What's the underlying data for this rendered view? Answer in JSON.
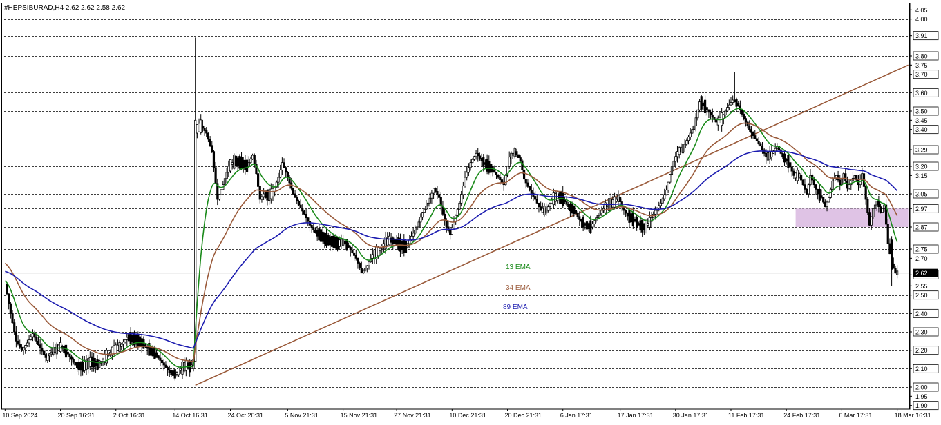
{
  "header": {
    "title": "#HEPSIBURAD,H4  2.62 2.62 2.58 2.62"
  },
  "colors": {
    "background": "#ffffff",
    "grid": "#000000",
    "candle": "#000000",
    "ema13": "#1a8a1a",
    "ema34": "#9a5a3a",
    "ema89": "#1c1cb0",
    "trendline": "#9a5a3a",
    "support_zone": "#d9b8e0",
    "current_price_tag": "#000000"
  },
  "chart_data": {
    "type": "candlestick",
    "symbol": "#HEPSIBURAD",
    "timeframe": "H4",
    "ohlc_header": {
      "open": 2.62,
      "high": 2.62,
      "low": 2.58,
      "close": 2.62
    },
    "ylim": [
      1.88,
      4.07
    ],
    "y_tick_labels": [
      "4.05",
      "4.00",
      "3.91",
      "3.80",
      "3.75",
      "3.70",
      "3.60",
      "3.50",
      "3.45",
      "3.40",
      "3.29",
      "3.20",
      "3.15",
      "3.05",
      "2.97",
      "2.87",
      "2.75",
      "2.70",
      "2.61",
      "2.55",
      "2.50",
      "2.40",
      "2.30",
      "2.20",
      "2.10",
      "2.00",
      "1.95",
      "1.90"
    ],
    "grid_levels": [
      4.0,
      3.91,
      3.8,
      3.7,
      3.6,
      3.5,
      3.4,
      3.29,
      3.2,
      3.05,
      2.97,
      2.87,
      2.75,
      2.61,
      2.5,
      2.4,
      2.3,
      2.2,
      2.1,
      2.0,
      1.9
    ],
    "highlighted_labels": [
      "3.91",
      "3.80",
      "3.70",
      "3.60",
      "3.50",
      "3.40",
      "3.29",
      "3.20",
      "3.05",
      "2.97",
      "2.87",
      "2.75",
      "2.61",
      "2.50",
      "2.40",
      "2.30",
      "2.20",
      "2.10",
      "2.00",
      "1.90"
    ],
    "x_tick_labels": [
      "10 Sep 2024",
      "20 Sep 16:31",
      "2 Oct 16:31",
      "14 Oct 16:31",
      "24 Oct 20:31",
      "5 Nov 21:31",
      "15 Nov 21:31",
      "27 Nov 21:31",
      "10 Dec 21:31",
      "20 Dec 21:31",
      "6 Jan 17:31",
      "17 Jan 17:31",
      "30 Jan 17:31",
      "11 Feb 17:31",
      "24 Feb 17:31",
      "6 Mar 17:31",
      "18 Mar 16:31"
    ],
    "x_tick_index": [
      0,
      30,
      60,
      92,
      122,
      153,
      183,
      212,
      242,
      272,
      302,
      333,
      363,
      393,
      423,
      453,
      483
    ],
    "bar_count": 490,
    "closes": [
      [
        0,
        2.56
      ],
      [
        3,
        2.4
      ],
      [
        6,
        2.25
      ],
      [
        9,
        2.2
      ],
      [
        12,
        2.24
      ],
      [
        15,
        2.29
      ],
      [
        18,
        2.23
      ],
      [
        22,
        2.16
      ],
      [
        26,
        2.2
      ],
      [
        30,
        2.22
      ],
      [
        34,
        2.18
      ],
      [
        38,
        2.12
      ],
      [
        42,
        2.11
      ],
      [
        46,
        2.14
      ],
      [
        50,
        2.12
      ],
      [
        54,
        2.16
      ],
      [
        58,
        2.2
      ],
      [
        62,
        2.22
      ],
      [
        66,
        2.27
      ],
      [
        70,
        2.26
      ],
      [
        74,
        2.24
      ],
      [
        78,
        2.2
      ],
      [
        82,
        2.17
      ],
      [
        86,
        2.12
      ],
      [
        89,
        2.08
      ],
      [
        92,
        2.07
      ],
      [
        95,
        2.1
      ],
      [
        98,
        2.12
      ],
      [
        100,
        2.11
      ],
      [
        102,
        2.13
      ],
      [
        103,
        3.4
      ],
      [
        106,
        3.42
      ],
      [
        109,
        3.38
      ],
      [
        112,
        3.28
      ],
      [
        115,
        3.02
      ],
      [
        118,
        3.1
      ],
      [
        121,
        3.2
      ],
      [
        124,
        3.23
      ],
      [
        127,
        3.22
      ],
      [
        131,
        3.2
      ],
      [
        134,
        3.26
      ],
      [
        136,
        3.16
      ],
      [
        138,
        3.02
      ],
      [
        140,
        3.05
      ],
      [
        142,
        3.04
      ],
      [
        145,
        3.06
      ],
      [
        148,
        3.14
      ],
      [
        150,
        3.22
      ],
      [
        153,
        3.14
      ],
      [
        156,
        3.05
      ],
      [
        159,
        2.99
      ],
      [
        162,
        2.94
      ],
      [
        165,
        2.88
      ],
      [
        168,
        2.84
      ],
      [
        171,
        2.82
      ],
      [
        174,
        2.8
      ],
      [
        177,
        2.79
      ],
      [
        180,
        2.78
      ],
      [
        183,
        2.79
      ],
      [
        186,
        2.76
      ],
      [
        190,
        2.7
      ],
      [
        193,
        2.62
      ],
      [
        196,
        2.66
      ],
      [
        199,
        2.72
      ],
      [
        202,
        2.74
      ],
      [
        205,
        2.78
      ],
      [
        208,
        2.8
      ],
      [
        211,
        2.79
      ],
      [
        214,
        2.77
      ],
      [
        217,
        2.76
      ],
      [
        220,
        2.82
      ],
      [
        223,
        2.87
      ],
      [
        226,
        2.95
      ],
      [
        229,
        3.0
      ],
      [
        232,
        3.08
      ],
      [
        235,
        3.03
      ],
      [
        237,
        2.94
      ],
      [
        239,
        2.87
      ],
      [
        241,
        2.83
      ],
      [
        243,
        2.9
      ],
      [
        246,
        3.0
      ],
      [
        249,
        3.14
      ],
      [
        252,
        3.22
      ],
      [
        255,
        3.27
      ],
      [
        258,
        3.23
      ],
      [
        261,
        3.2
      ],
      [
        264,
        3.18
      ],
      [
        267,
        3.14
      ],
      [
        270,
        3.1
      ],
      [
        273,
        3.25
      ],
      [
        276,
        3.28
      ],
      [
        279,
        3.23
      ],
      [
        281,
        3.13
      ],
      [
        284,
        3.07
      ],
      [
        287,
        3.02
      ],
      [
        290,
        2.96
      ],
      [
        293,
        2.96
      ],
      [
        296,
        3.02
      ],
      [
        299,
        3.04
      ],
      [
        302,
        3.02
      ],
      [
        305,
        2.98
      ],
      [
        308,
        2.96
      ],
      [
        311,
        2.91
      ],
      [
        314,
        2.88
      ],
      [
        317,
        2.87
      ],
      [
        320,
        2.92
      ],
      [
        323,
        2.96
      ],
      [
        326,
        2.99
      ],
      [
        329,
        3.0
      ],
      [
        332,
        3.03
      ],
      [
        335,
        2.96
      ],
      [
        337,
        2.93
      ],
      [
        340,
        2.91
      ],
      [
        343,
        2.88
      ],
      [
        346,
        2.87
      ],
      [
        349,
        2.9
      ],
      [
        352,
        2.96
      ],
      [
        355,
        3.0
      ],
      [
        358,
        3.07
      ],
      [
        361,
        3.2
      ],
      [
        364,
        3.28
      ],
      [
        367,
        3.3
      ],
      [
        370,
        3.36
      ],
      [
        373,
        3.42
      ],
      [
        376,
        3.55
      ],
      [
        379,
        3.52
      ],
      [
        382,
        3.48
      ],
      [
        385,
        3.44
      ],
      [
        388,
        3.46
      ],
      [
        391,
        3.52
      ],
      [
        394,
        3.56
      ],
      [
        397,
        3.53
      ],
      [
        400,
        3.46
      ],
      [
        403,
        3.4
      ],
      [
        406,
        3.35
      ],
      [
        409,
        3.31
      ],
      [
        412,
        3.25
      ],
      [
        415,
        3.27
      ],
      [
        418,
        3.31
      ],
      [
        421,
        3.25
      ],
      [
        424,
        3.22
      ],
      [
        427,
        3.15
      ],
      [
        430,
        3.15
      ],
      [
        432,
        3.1
      ],
      [
        434,
        3.05
      ],
      [
        436,
        3.15
      ],
      [
        438,
        3.1
      ],
      [
        440,
        3.05
      ],
      [
        442,
        3.03
      ],
      [
        444,
        2.98
      ],
      [
        446,
        3.03
      ],
      [
        448,
        3.12
      ],
      [
        450,
        3.15
      ],
      [
        452,
        3.1
      ],
      [
        454,
        3.16
      ],
      [
        456,
        3.08
      ],
      [
        458,
        3.12
      ],
      [
        460,
        3.15
      ],
      [
        462,
        3.1
      ],
      [
        464,
        3.16
      ],
      [
        466,
        3.02
      ],
      [
        468,
        2.88
      ],
      [
        470,
        2.97
      ],
      [
        472,
        3.01
      ],
      [
        474,
        2.95
      ],
      [
        476,
        2.99
      ],
      [
        478,
        2.78
      ],
      [
        480,
        2.67
      ],
      [
        482,
        2.62
      ],
      [
        483,
        2.62
      ]
    ],
    "trendline": {
      "from": [
        103,
        2.01
      ],
      "to": [
        489,
        3.75
      ]
    },
    "support_zone": {
      "from_index": 428,
      "to_index": 489,
      "low": 2.87,
      "high": 2.97
    },
    "series": [
      {
        "name": "13 EMA",
        "period": 13
      },
      {
        "name": "34 EMA",
        "period": 34
      },
      {
        "name": "89 EMA",
        "period": 89
      }
    ],
    "ema_seed": {
      "ema13": 2.58,
      "ema34": 2.68,
      "ema89": 2.63
    },
    "current_price": "2.62",
    "grid": true
  }
}
